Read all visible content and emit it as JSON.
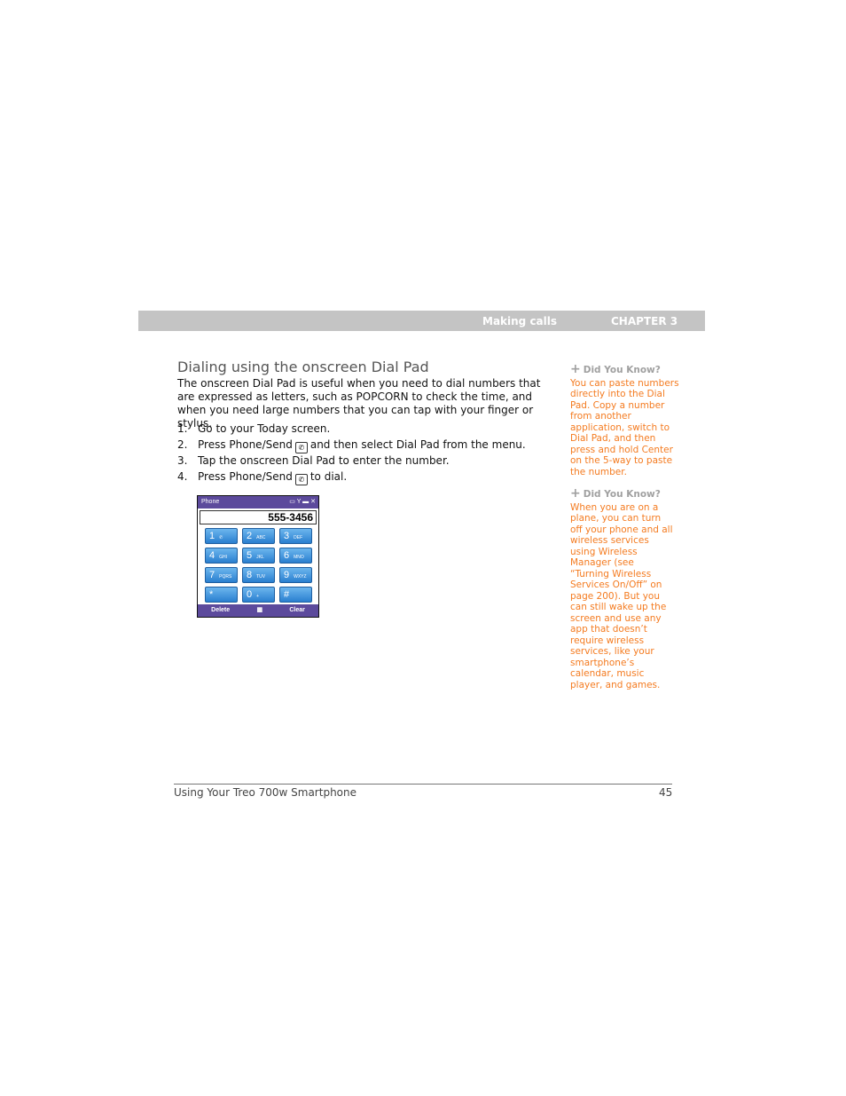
{
  "header": {
    "section": "Making calls",
    "chapter": "CHAPTER 3"
  },
  "title": "Dialing using the onscreen Dial Pad",
  "intro": "The onscreen Dial Pad is useful when you need to dial numbers that are expressed as letters, such as POPCORN to check the time, and when you need large numbers that you can tap with your finger or stylus.",
  "steps": [
    {
      "n": "1.",
      "pre": "Go to your Today screen.",
      "post": ""
    },
    {
      "n": "2.",
      "pre": "Press Phone/Send",
      "post": "and then select Dial Pad from the menu."
    },
    {
      "n": "3.",
      "pre": "Tap the onscreen Dial Pad to enter the number.",
      "post": ""
    },
    {
      "n": "4.",
      "pre": "Press Phone/Send",
      "post": "to dial."
    }
  ],
  "phone": {
    "title": "Phone",
    "number": "555-3456",
    "keys": [
      {
        "d": "1",
        "l": "✆"
      },
      {
        "d": "2",
        "l": "ABC"
      },
      {
        "d": "3",
        "l": "DEF"
      },
      {
        "d": "4",
        "l": "GHI"
      },
      {
        "d": "5",
        "l": "JKL"
      },
      {
        "d": "6",
        "l": "MNO"
      },
      {
        "d": "7",
        "l": "PQRS"
      },
      {
        "d": "8",
        "l": "TUV"
      },
      {
        "d": "9",
        "l": "WXYZ"
      },
      {
        "d": "*",
        "l": ""
      },
      {
        "d": "0",
        "l": "+"
      },
      {
        "d": "#",
        "l": ""
      }
    ],
    "delete": "Delete",
    "clear": "Clear"
  },
  "sidebar": [
    {
      "heading": "Did You Know?",
      "text": "You can paste numbers directly into the Dial Pad. Copy a number from another application, switch to Dial Pad, and then press and hold Center on the 5-way to paste the number."
    },
    {
      "heading": "Did You Know?",
      "text": "When you are on a plane, you can turn off your phone and all wireless services using Wireless Manager (see “Turning Wireless Services On/Off” on page 200). But you can still wake up the screen and use any app that doesn’t require wireless services, like your smartphone’s calendar, music player, and games."
    }
  ],
  "footer": {
    "title": "Using Your Treo 700w Smartphone",
    "page": "45"
  },
  "colors": {
    "accent": "#f47b20",
    "header_bar": "#c4c4c4"
  }
}
